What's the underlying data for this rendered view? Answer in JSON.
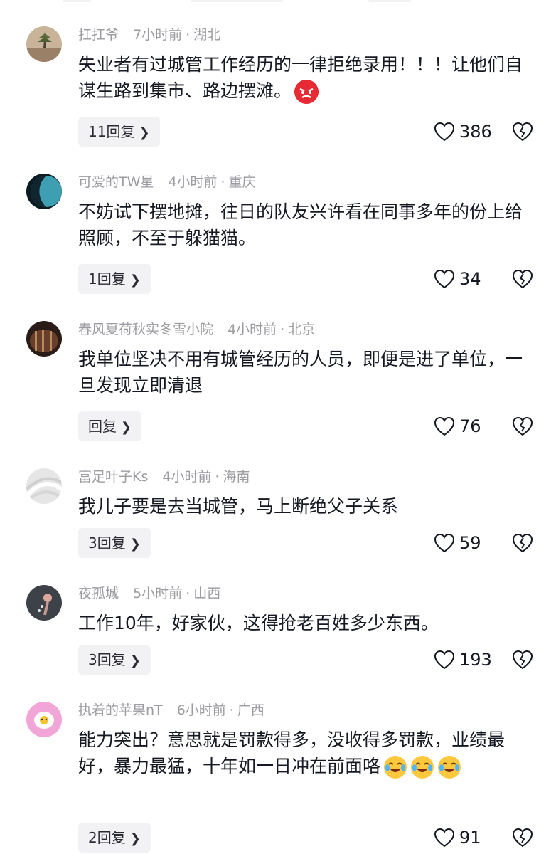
{
  "comments": [
    {
      "username": "扛扛爷",
      "time": "7小时前",
      "location": "湖北",
      "text": "失业者有过城管工作经历的一律拒绝录用！！！让他们自谋生路到集市、路边摆滩。",
      "reply_label": "11回复",
      "likes": "386",
      "emoji": "angry-face"
    },
    {
      "username": "可爱的TW星",
      "time": "4小时前",
      "location": "重庆",
      "text": "不妨试下摆地摊，往日的队友兴许看在同事多年的份上给照顾，不至于躲猫猫。",
      "reply_label": "1回复",
      "likes": "34"
    },
    {
      "username": "春风夏荷秋实冬雪小院",
      "time": "4小时前",
      "location": "北京",
      "text": "我单位坚决不用有城管经历的人员，即便是进了单位，一旦发现立即清退",
      "reply_label": "回复",
      "likes": "76"
    },
    {
      "username": "富足叶子Ks",
      "time": "4小时前",
      "location": "海南",
      "text": "我儿子要是去当城管，马上断绝父子关系",
      "reply_label": "3回复",
      "likes": "59"
    },
    {
      "username": "夜孤城",
      "time": "5小时前",
      "location": "山西",
      "text": "工作10年，好家伙，这得抢老百姓多少东西。",
      "reply_label": "3回复",
      "likes": "193"
    },
    {
      "username": "执着的苹果nT",
      "time": "6小时前",
      "location": "广西",
      "text": "能力突出？意思就是罚款得多，没收得多罚款，业绩最好，暴力最猛，十年如一日冲在前面咯",
      "reply_label": "2回复",
      "likes": "91",
      "emoji": "laughing-crying-face"
    }
  ],
  "icons": {
    "like": "heart-outline-icon",
    "dislike": "broken-heart-icon",
    "reply_arrow": "chevron-right-icon"
  },
  "colors": {
    "text": "#161823",
    "meta": "#9b9ba1",
    "reply_bg": "#f2f2f4"
  }
}
